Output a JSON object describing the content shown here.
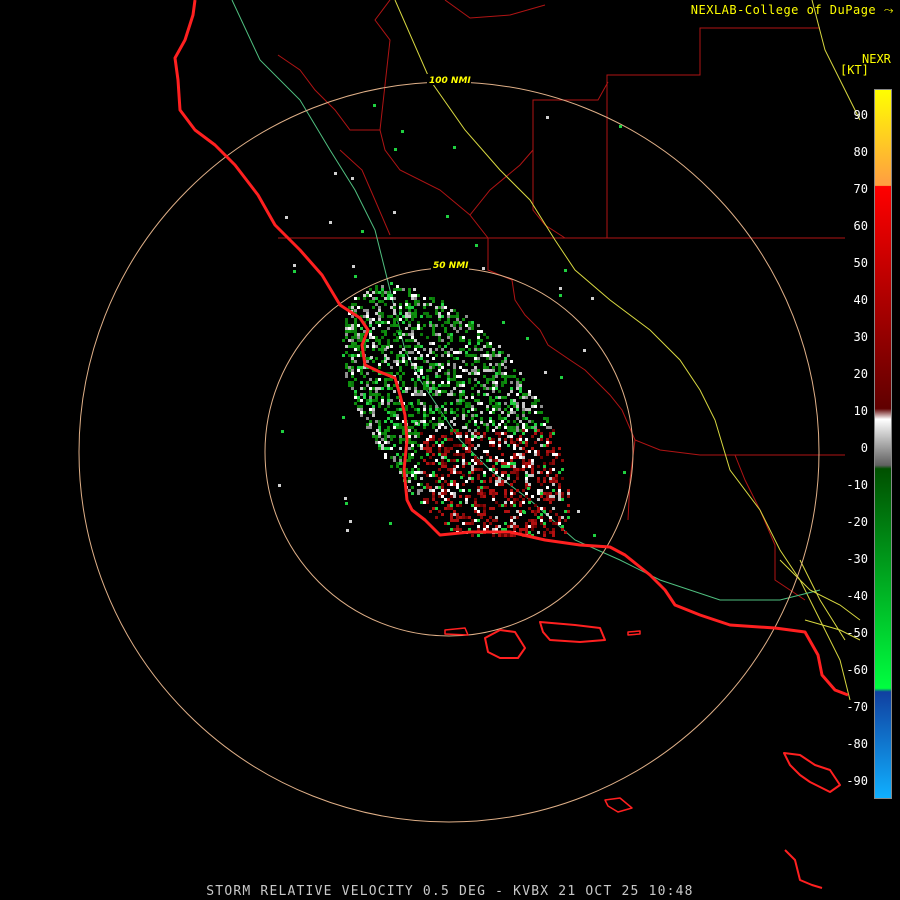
{
  "credit": "NEXLAB-College of DuPage",
  "credit_logo": "⤳",
  "legend": {
    "product": "NEXR",
    "unit": "[KT]",
    "ticks": [
      "90",
      "80",
      "70",
      "60",
      "50",
      "40",
      "30",
      "20",
      "10",
      "0",
      "-10",
      "-20",
      "-30",
      "-40",
      "-50",
      "-60",
      "-70",
      "-80",
      "-90"
    ],
    "colors": {
      "yellow": "#ffff00",
      "orange": "#ffa040",
      "red": "#ff0000",
      "dark_red": "#600000",
      "white": "#ffffff",
      "gray": "#606060",
      "dark_green": "#005000",
      "green": "#00ff40",
      "dark_blue": "#1040a0",
      "light_blue": "#10b0ff"
    }
  },
  "range_rings": [
    "100 NMI",
    "50 NMI"
  ],
  "caption": "STORM RELATIVE VELOCITY 0.5 DEG - KVBX 21 OCT 25 10:48",
  "map_colors": {
    "coastline": "#ff2020",
    "county_lines": "#c01818",
    "range_rings": "#e8b890",
    "highway_yellow": "#e0e040",
    "highway_green": "#60d090"
  }
}
